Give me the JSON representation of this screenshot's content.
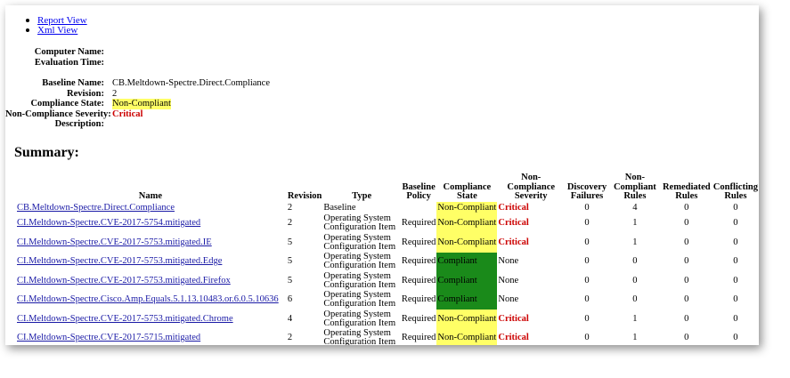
{
  "nav": {
    "report_view": "Report View",
    "xml_view": "Xml View"
  },
  "computer": {
    "name_label": "Computer Name:",
    "name_value": "",
    "time_label": "Evaluation Time:",
    "time_value": ""
  },
  "baseline": {
    "name_label": "Baseline Name:",
    "name_value": "CB.Meltdown-Spectre.Direct.Compliance",
    "revision_label": "Revision:",
    "revision_value": "2",
    "state_label": "Compliance State:",
    "state_value": "Non-Compliant",
    "severity_label": "Non-Compliance Severity:",
    "severity_value": "Critical",
    "description_label": "Description:",
    "description_value": ""
  },
  "summary": {
    "title": "Summary:",
    "headers": {
      "name": "Name",
      "revision": "Revision",
      "type": "Type",
      "baseline_policy": "Baseline Policy",
      "compliance_state": "Compliance State",
      "severity": "Non-Compliance Severity",
      "discovery_failures": "Discovery Failures",
      "noncompliant_rules": "Non-Compliant Rules",
      "remediated_rules": "Remediated Rules",
      "conflicting_rules": "Conflicting Rules"
    },
    "rows": [
      {
        "name": "CB.Meltdown-Spectre.Direct.Compliance",
        "revision": "2",
        "type": "Baseline",
        "policy": "",
        "state": "Non-Compliant",
        "state_color": "#ffff66",
        "severity": "Critical",
        "discovery": "0",
        "noncompliant": "4",
        "remediated": "0",
        "conflicting": "0"
      },
      {
        "name": "CI.Meltdown-Spectre.CVE-2017-5754.mitigated",
        "revision": "2",
        "type": "Operating System Configuration Item",
        "policy": "Required",
        "state": "Non-Compliant",
        "state_color": "#ffff66",
        "severity": "Critical",
        "discovery": "0",
        "noncompliant": "1",
        "remediated": "0",
        "conflicting": "0"
      },
      {
        "name": "CI.Meltdown-Spectre.CVE-2017-5753.mitigated.IE",
        "revision": "5",
        "type": "Operating System Configuration Item",
        "policy": "Required",
        "state": "Non-Compliant",
        "state_color": "#ffff66",
        "severity": "Critical",
        "discovery": "0",
        "noncompliant": "1",
        "remediated": "0",
        "conflicting": "0"
      },
      {
        "name": "CI.Meltdown-Spectre.CVE-2017-5753.mitigated.Edge",
        "revision": "5",
        "type": "Operating System Configuration Item",
        "policy": "Required",
        "state": "Compliant",
        "state_color": "#1a8a1a",
        "severity": "None",
        "discovery": "0",
        "noncompliant": "0",
        "remediated": "0",
        "conflicting": "0"
      },
      {
        "name": "CI.Meltdown-Spectre.CVE-2017-5753.mitigated.Firefox",
        "revision": "5",
        "type": "Operating System Configuration Item",
        "policy": "Required",
        "state": "Compliant",
        "state_color": "#1a8a1a",
        "severity": "None",
        "discovery": "0",
        "noncompliant": "0",
        "remediated": "0",
        "conflicting": "0"
      },
      {
        "name": "CI.Meltdown-Spectre.Cisco.Amp.Equals.5.1.13.10483.or.6.0.5.10636",
        "revision": "6",
        "type": "Operating System Configuration Item",
        "policy": "Required",
        "state": "Compliant",
        "state_color": "#1a8a1a",
        "severity": "None",
        "discovery": "0",
        "noncompliant": "0",
        "remediated": "0",
        "conflicting": "0"
      },
      {
        "name": "CI.Meltdown-Spectre.CVE-2017-5753.mitigated.Chrome",
        "revision": "4",
        "type": "Operating System Configuration Item",
        "policy": "Required",
        "state": "Non-Compliant",
        "state_color": "#ffff66",
        "severity": "Critical",
        "discovery": "0",
        "noncompliant": "1",
        "remediated": "0",
        "conflicting": "0"
      },
      {
        "name": "CI.Meltdown-Spectre.CVE-2017-5715.mitigated",
        "revision": "2",
        "type": "Operating System Configuration Item",
        "policy": "Required",
        "state": "Non-Compliant",
        "state_color": "#ffff66",
        "severity": "Critical",
        "discovery": "0",
        "noncompliant": "1",
        "remediated": "0",
        "conflicting": "0"
      }
    ]
  }
}
